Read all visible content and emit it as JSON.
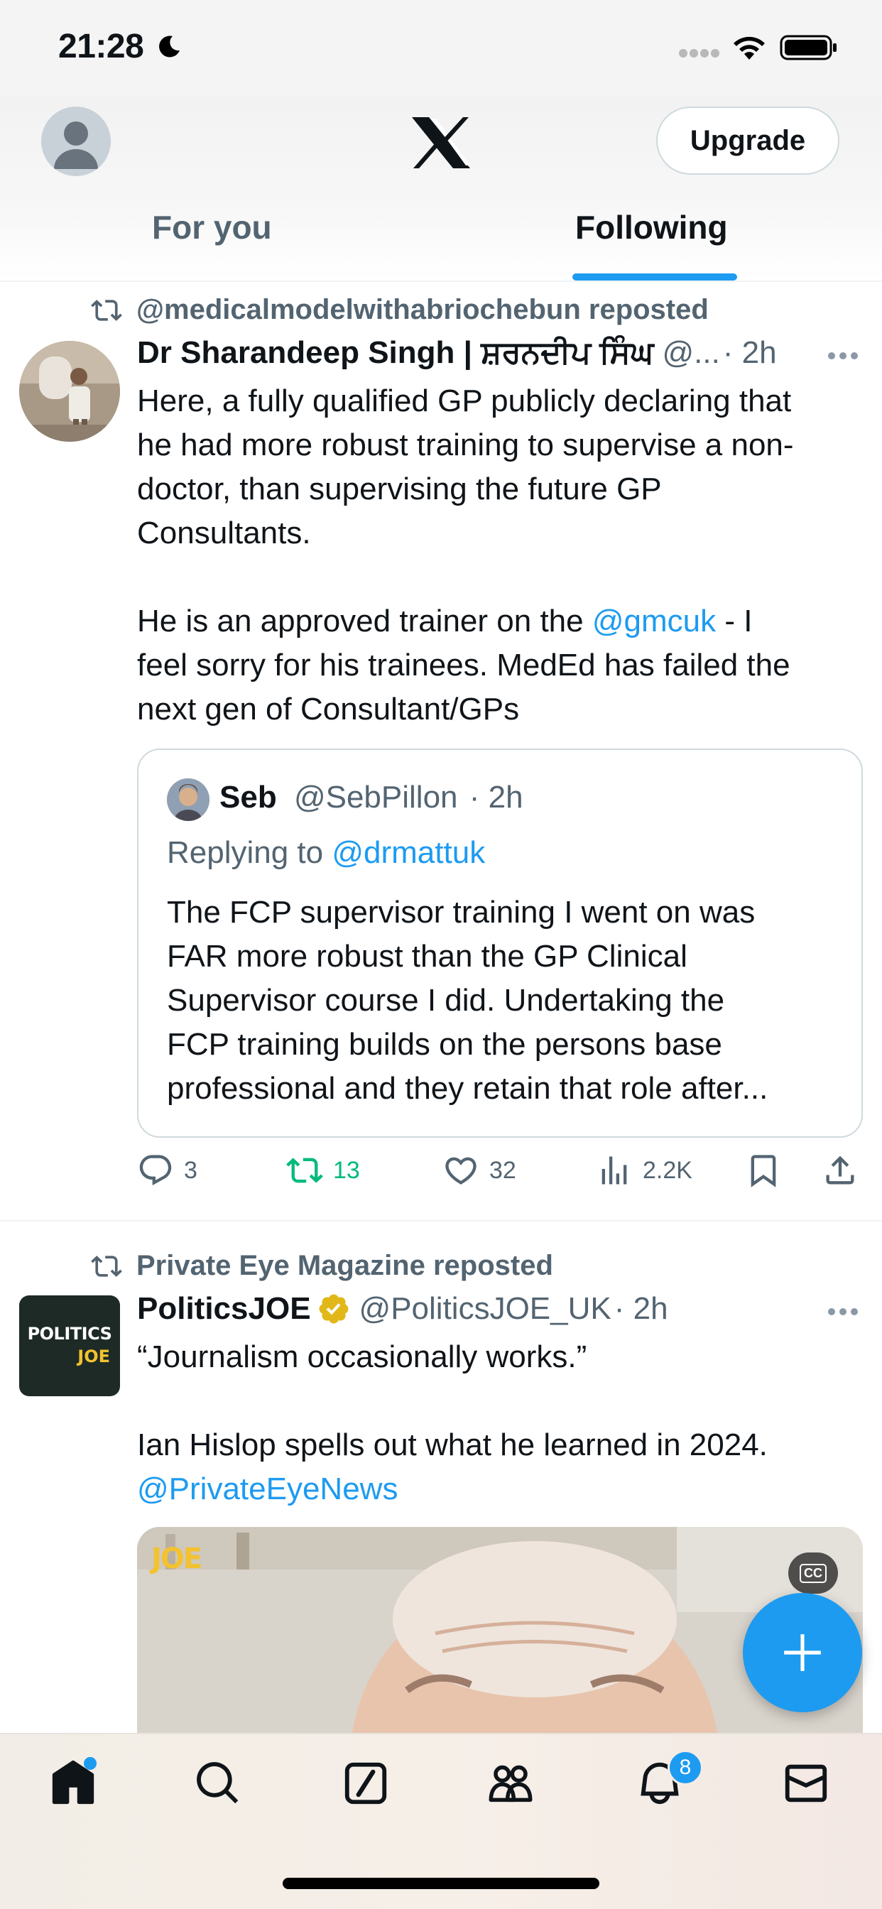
{
  "status_bar": {
    "time": "21:28"
  },
  "header": {
    "upgrade_label": "Upgrade",
    "tabs": [
      {
        "label": "For you",
        "active": false
      },
      {
        "label": "Following",
        "active": true
      }
    ],
    "accent_color": "#1d9bf0"
  },
  "tweets": [
    {
      "repost_by": "@medicalmodelwithabriochebun reposted",
      "name": "Dr Sharandeep Singh | ਸ਼ਰਨਦੀਪ ਸਿੰਘ",
      "handle": "@...",
      "time": "· 2h",
      "text_lines": [
        "Here, a fully qualified GP publicly declaring that",
        "he had more robust training to supervise a non-",
        "doctor, than supervising the future GP",
        "Consultants."
      ],
      "text2_before_link": "He is an approved trainer on the ",
      "text2_link": "@gmcuk",
      "text2_after_link": " - I",
      "text2_lines": [
        "feel sorry for his trainees. MedEd has failed the",
        "next gen of Consultant/GPs"
      ],
      "quote": {
        "name": "Seb",
        "handle": "@SebPillon",
        "time": "· 2h",
        "replying_label": "Replying to ",
        "replying_handle": "@drmattuk",
        "text_lines": [
          "The FCP supervisor training I went on was",
          "FAR more robust than the GP Clinical",
          "Supervisor course I did. Undertaking the",
          "FCP training builds on the persons base",
          "professional and they retain that role after..."
        ]
      },
      "actions": {
        "replies": "3",
        "reposts": "13",
        "likes": "32",
        "views": "2.2K"
      }
    },
    {
      "repost_by": "Private Eye Magazine reposted",
      "name": "PoliticsJOE",
      "handle": "@PoliticsJOE_UK",
      "time": "· 2h",
      "avatar_text_1": "POLITICS",
      "avatar_text_2": "JOE",
      "text_line1": "“Journalism occasionally works.”",
      "text_line2": "Ian Hislop spells out what he learned in 2024.",
      "text_link": "@PrivateEyeNews",
      "media_watermark": "JOE",
      "cc_label": "CC"
    }
  ],
  "bottom_nav": {
    "items": [
      "home-icon",
      "search-icon",
      "grok-icon",
      "communities-icon",
      "notifications-icon",
      "messages-icon"
    ],
    "notifications_count": "8"
  }
}
